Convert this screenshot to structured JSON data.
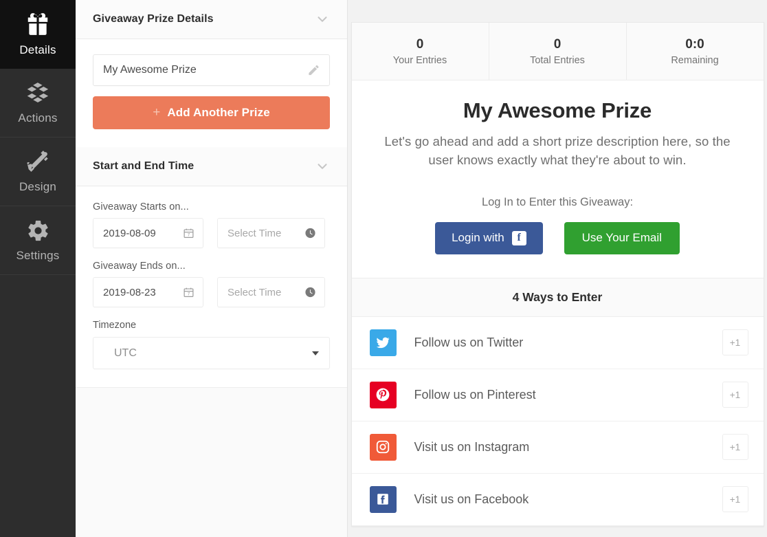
{
  "rail": {
    "items": [
      {
        "label": "Details",
        "icon": "gift-icon",
        "active": true
      },
      {
        "label": "Actions",
        "icon": "blocks-icon",
        "active": false
      },
      {
        "label": "Design",
        "icon": "brush-icon",
        "active": false
      },
      {
        "label": "Settings",
        "icon": "gear-icon",
        "active": false
      }
    ]
  },
  "panel": {
    "prize_section": {
      "title": "Giveaway Prize Details",
      "collapse_icon": "chevron-down-icon",
      "prize_name_value": "My Awesome Prize",
      "prize_name_placeholder": "My Awesome Prize",
      "edit_icon": "pencil-icon",
      "add_prize_label": "Add Another Prize",
      "add_prize_icon": "plus-icon",
      "add_prize_color": "#ec7b5a"
    },
    "time_section": {
      "title": "Start and End Time",
      "collapse_icon": "chevron-down-icon",
      "start_label": "Giveaway Starts on...",
      "start_date": "2019-08-09",
      "start_time_placeholder": "Select Time",
      "end_label": "Giveaway Ends on...",
      "end_date": "2019-08-23",
      "end_time_placeholder": "Select Time",
      "date_icon": "calendar-icon",
      "time_icon": "clock-icon",
      "timezone_label": "Timezone",
      "timezone_value": "UTC",
      "timezone_caret": "caret-down-icon"
    }
  },
  "preview": {
    "stats": [
      {
        "num": "0",
        "cap": "Your Entries"
      },
      {
        "num": "0",
        "cap": "Total Entries"
      },
      {
        "num": "0:0",
        "cap": "Remaining"
      }
    ],
    "prize_title": "My Awesome Prize",
    "prize_description": "Let's go ahead and add a short prize description here, so the user knows exactly what they're about to win.",
    "login_caption": "Log In to Enter this Giveaway:",
    "facebook_button_label": "Login with",
    "facebook_button_icon": "facebook-icon",
    "facebook_button_color": "#3b5998",
    "email_button_label": "Use Your Email",
    "email_button_color": "#30a030",
    "ways_title": "4 Ways to Enter",
    "entries": [
      {
        "label": "Follow us on Twitter",
        "icon": "twitter-icon",
        "color": "#3aa9e8",
        "badge": "+1"
      },
      {
        "label": "Follow us on Pinterest",
        "icon": "pinterest-icon",
        "color": "#e60023",
        "badge": "+1"
      },
      {
        "label": "Visit us on Instagram",
        "icon": "instagram-icon",
        "color": "#f05a38",
        "badge": "+1"
      },
      {
        "label": "Visit us on Facebook",
        "icon": "facebook-icon",
        "color": "#3b5998",
        "badge": "+1"
      }
    ]
  }
}
